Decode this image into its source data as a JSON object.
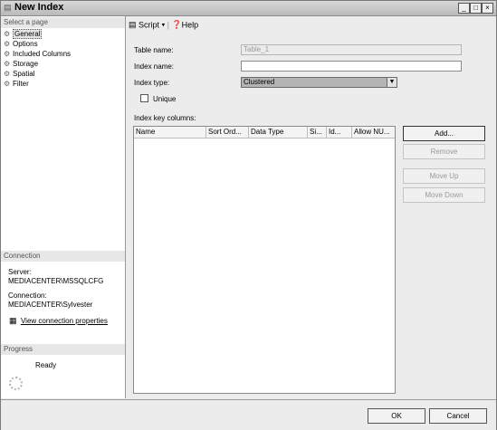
{
  "window": {
    "title": "New Index"
  },
  "left_panel": {
    "select_page_header": "Select a page",
    "pages": [
      {
        "label": "General",
        "selected": true
      },
      {
        "label": "Options"
      },
      {
        "label": "Included Columns"
      },
      {
        "label": "Storage"
      },
      {
        "label": "Spatial"
      },
      {
        "label": "Filter"
      }
    ],
    "connection_header": "Connection",
    "server_label": "Server:",
    "server_value": "MEDIACENTER\\MSSQLCFG",
    "connection_label": "Connection:",
    "connection_value": "MEDIACENTER\\Sylvester",
    "view_connection_link": "View connection properties",
    "progress_header": "Progress",
    "progress_status": "Ready"
  },
  "toolbar": {
    "script_label": "Script",
    "help_label": "Help"
  },
  "form": {
    "table_name_label": "Table name:",
    "table_name_value": "Table_1",
    "index_name_label": "Index name:",
    "index_name_value": "",
    "index_type_label": "Index type:",
    "index_type_value": "Clustered",
    "unique_label": "Unique",
    "unique_checked": false,
    "key_columns_label": "Index key columns:"
  },
  "grid": {
    "columns": [
      "Name",
      "Sort Ord...",
      "Data Type",
      "Si...",
      "Id...",
      "Allow NU..."
    ],
    "rows": []
  },
  "buttons": {
    "add": "Add...",
    "remove": "Remove",
    "move_up": "Move Up",
    "move_down": "Move Down",
    "ok": "OK",
    "cancel": "Cancel"
  }
}
